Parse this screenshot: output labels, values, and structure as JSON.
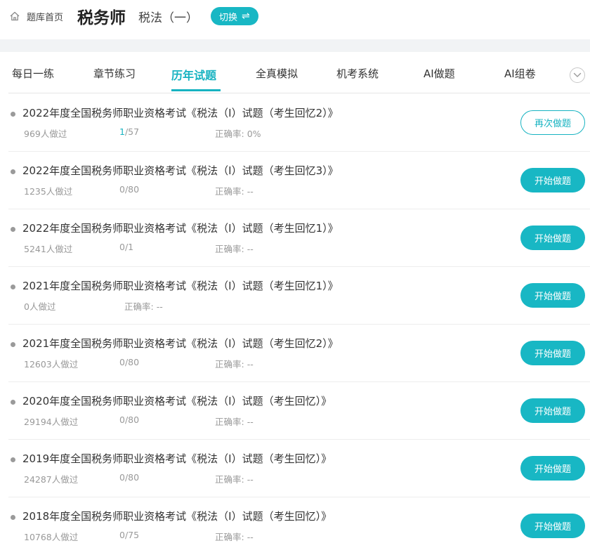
{
  "header": {
    "home_label": "题库首页",
    "title": "税务师",
    "subtitle": "税法（一）",
    "switch_label": "切换",
    "switch_icon": "⇌"
  },
  "tabs": [
    {
      "label": "每日一练"
    },
    {
      "label": "章节练习"
    },
    {
      "label": "历年试题"
    },
    {
      "label": "全真模拟"
    },
    {
      "label": "机考系统"
    },
    {
      "label": "AI做题"
    },
    {
      "label": "AI组卷"
    }
  ],
  "active_tab": "历年试题",
  "colors": {
    "accent": "#18b7c4"
  },
  "exams": [
    {
      "title": "2022年度全国税务师职业资格考试《税法（Ⅰ）试题（考生回忆2）》",
      "count": "969人做过",
      "progress_done": "1",
      "progress_total": "/57",
      "rate_label": "正确率:",
      "rate": "0%",
      "action": "再次做题"
    },
    {
      "title": "2022年度全国税务师职业资格考试《税法（Ⅰ）试题（考生回忆3）》",
      "count": "1235人做过",
      "progress": "0/80",
      "rate_label": "正确率:",
      "rate": "--",
      "action": "开始做题"
    },
    {
      "title": "2022年度全国税务师职业资格考试《税法（Ⅰ）试题（考生回忆1）》",
      "count": "5241人做过",
      "progress": "0/1",
      "rate_label": "正确率:",
      "rate": "--",
      "action": "开始做题"
    },
    {
      "title": "2021年度全国税务师职业资格考试《税法（Ⅰ）试题（考生回忆1）》",
      "count": "0人做过",
      "progress": "",
      "rate_label": "正确率:",
      "rate": "--",
      "action": "开始做题"
    },
    {
      "title": "2021年度全国税务师职业资格考试《税法（Ⅰ）试题（考生回忆2）》",
      "count": "12603人做过",
      "progress": "0/80",
      "rate_label": "正确率:",
      "rate": "--",
      "action": "开始做题"
    },
    {
      "title": "2020年度全国税务师职业资格考试《税法（Ⅰ）试题（考生回忆）》",
      "count": "29194人做过",
      "progress": "0/80",
      "rate_label": "正确率:",
      "rate": "--",
      "action": "开始做题"
    },
    {
      "title": "2019年度全国税务师职业资格考试《税法（Ⅰ）试题（考生回忆）》",
      "count": "24287人做过",
      "progress": "0/80",
      "rate_label": "正确率:",
      "rate": "--",
      "action": "开始做题"
    },
    {
      "title": "2018年度全国税务师职业资格考试《税法（Ⅰ）试题（考生回忆）》",
      "count": "10768人做过",
      "progress": "0/75",
      "rate_label": "正确率:",
      "rate": "--",
      "action": "开始做题"
    }
  ]
}
